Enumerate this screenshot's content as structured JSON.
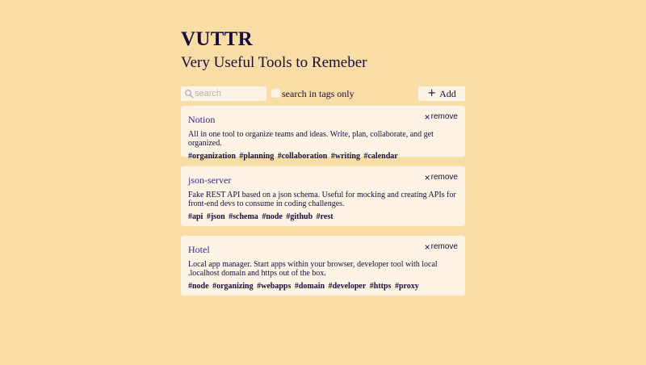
{
  "header": {
    "title": "VUTTR",
    "subtitle": "Very Useful Tools to Remeber"
  },
  "toolbar": {
    "search_placeholder": "search",
    "search_value": "",
    "tags_only_label": "search in tags only",
    "tags_only_checked": false,
    "add_label": "Add"
  },
  "tools": [
    {
      "title": "Notion",
      "remove_label": "remove",
      "description": "All in one tool to organize teams and ideas. Write, plan, collaborate, and get organized.",
      "tags": [
        "#organization",
        "#planning",
        "#collaboration",
        "#writing",
        "#calendar"
      ]
    },
    {
      "title": "json-server",
      "remove_label": "remove",
      "description": "Fake REST API based on a json schema. Useful for mocking and creating APIs for front-end devs to consume in coding challenges.",
      "tags": [
        "#api",
        "#json",
        "#schema",
        "#node",
        "#github",
        "#rest"
      ]
    },
    {
      "title": "Hotel",
      "remove_label": "remove",
      "description": "Local app manager. Start apps within your browser, developer tool with local .localhost domain and https out of the box.",
      "tags": [
        "#node",
        "#organizing",
        "#webapps",
        "#domain",
        "#developer",
        "#https",
        "#proxy"
      ]
    }
  ],
  "colors": {
    "background": "#f9dda6",
    "card": "#fcf3e4",
    "text": "#170c3a",
    "link": "#3a2a8c"
  }
}
